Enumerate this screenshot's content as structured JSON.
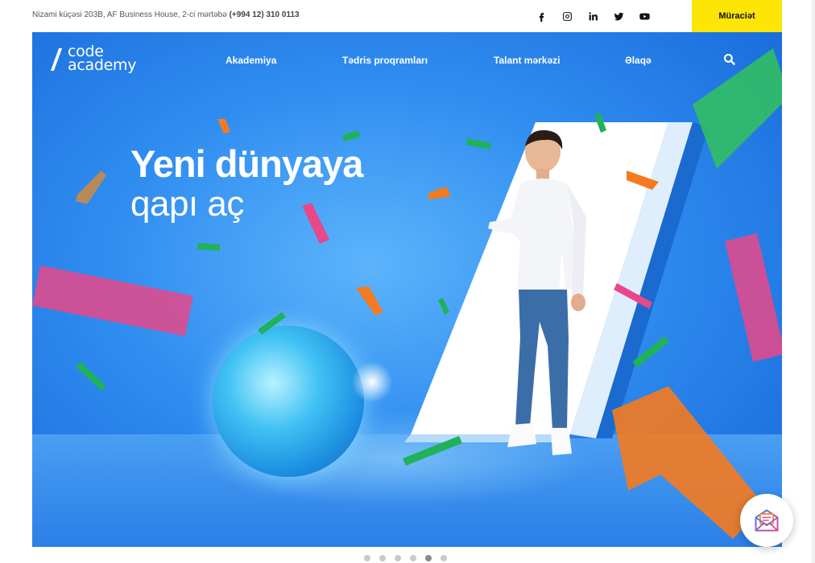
{
  "topbar": {
    "address": "Nizami küçəsi 203B, AF Business House, 2-ci mərtəbə",
    "phone": "(+994 12) 310 0113",
    "apply_label": "Müraciət",
    "socials": [
      "facebook-icon",
      "instagram-icon",
      "linkedin-icon",
      "twitter-icon",
      "youtube-icon"
    ]
  },
  "logo": {
    "line1": "code",
    "line2": "academy"
  },
  "nav": {
    "items": [
      "Akademiya",
      "Tədris proqramları",
      "Talant mərkəzi",
      "Əlaqə"
    ]
  },
  "hero": {
    "title_line1": "Yeni dünyaya",
    "title_line2": "qapı aç"
  },
  "slider": {
    "count": 6,
    "active_index": 4
  },
  "colors": {
    "accent": "#fde607",
    "hero_blue": "#2f8df0",
    "confetti_green": "#1fb25a",
    "confetti_pink": "#e8488a",
    "confetti_orange": "#f57a1f"
  },
  "icons": {
    "search": "search-icon",
    "chat": "mail-chat-icon"
  }
}
